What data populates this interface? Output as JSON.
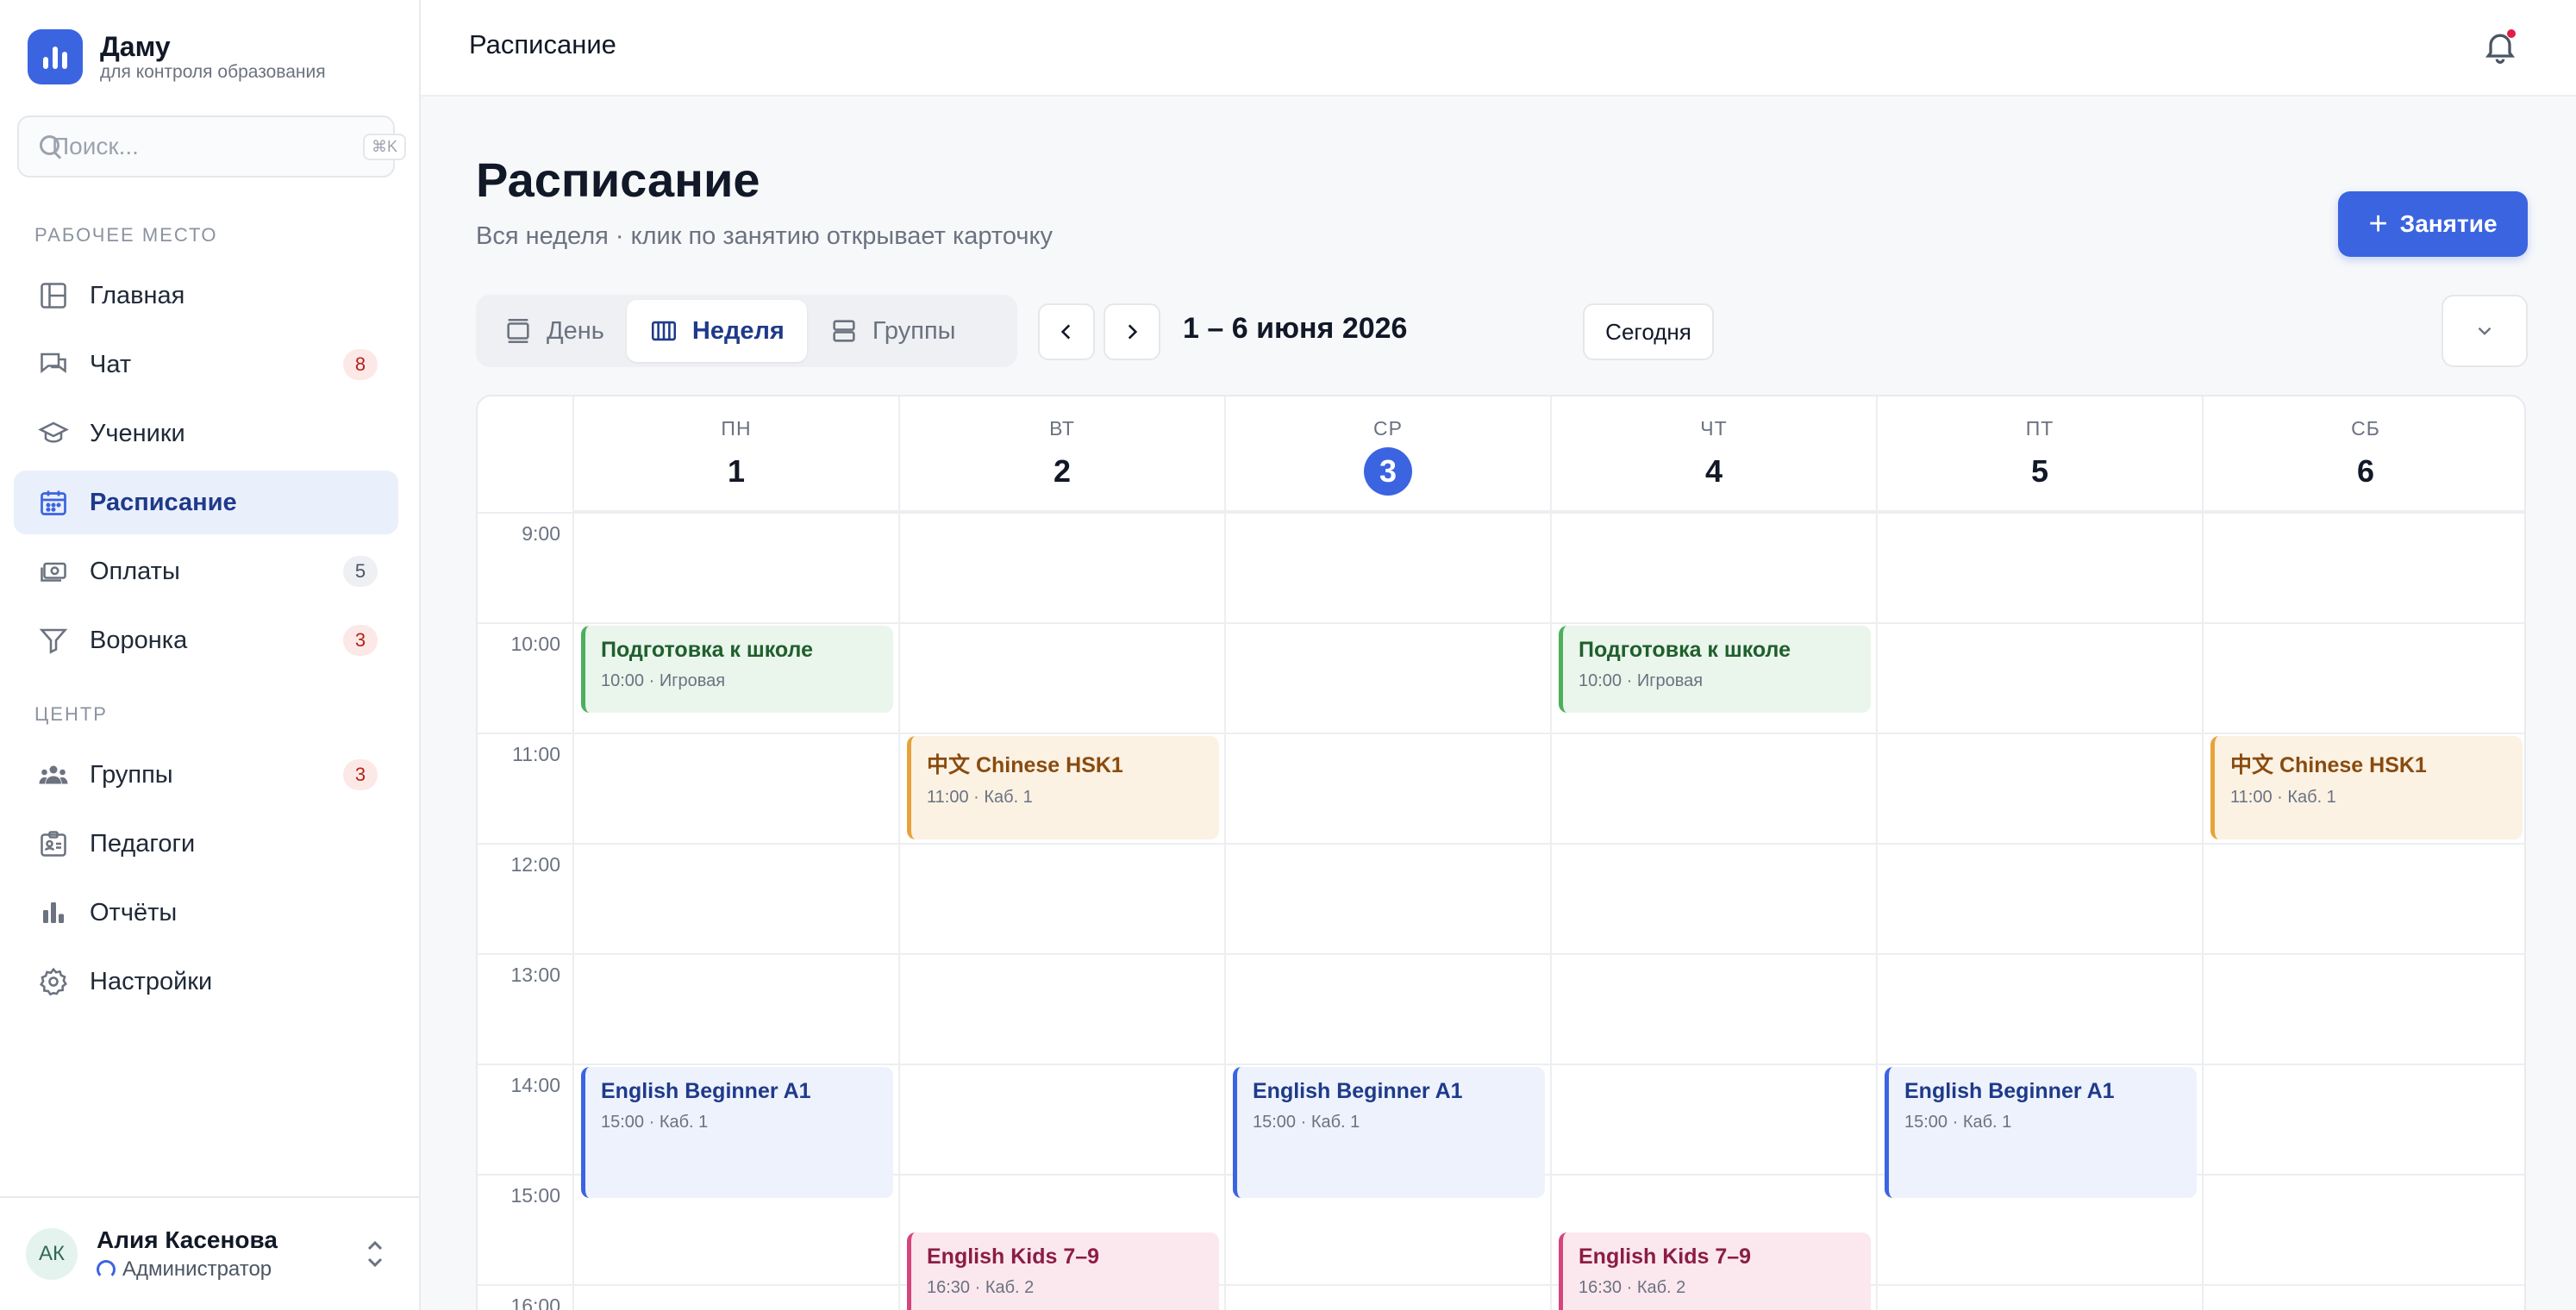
{
  "brand": {
    "name": "Даму",
    "subtitle": "для контроля образования"
  },
  "search": {
    "placeholder": "Поиск...",
    "shortcut": "⌘K"
  },
  "sidebar": {
    "workspace_label": "РАБОЧЕЕ МЕСТО",
    "center_label": "ЦЕНТР",
    "workspace_items": [
      {
        "label": "Главная",
        "icon": "layout-icon"
      },
      {
        "label": "Чат",
        "icon": "chat-icon",
        "badge": "8"
      },
      {
        "label": "Ученики",
        "icon": "graduation-cap-icon"
      },
      {
        "label": "Расписание",
        "icon": "calendar-icon",
        "active": true
      },
      {
        "label": "Оплаты",
        "icon": "cash-icon",
        "badge": "5"
      },
      {
        "label": "Воронка",
        "icon": "funnel-icon",
        "badge": "3"
      }
    ],
    "center_items": [
      {
        "label": "Группы",
        "icon": "users-icon",
        "badge": "3"
      },
      {
        "label": "Педагоги",
        "icon": "id-card-icon"
      },
      {
        "label": "Отчёты",
        "icon": "bar-chart-icon"
      },
      {
        "label": "Настройки",
        "icon": "gear-icon"
      }
    ]
  },
  "user": {
    "initials": "АК",
    "name": "Алия Касенова",
    "role": "Администратор"
  },
  "topbar": {
    "title": "Расписание"
  },
  "page": {
    "title": "Расписание",
    "subtitle": "Вся неделя · клик по занятию открывает карточку",
    "add_button": "Занятие"
  },
  "toolbar": {
    "views": [
      "День",
      "Неделя",
      "Группы"
    ],
    "active_view": "Неделя",
    "range": "1 – 6 июня 2026",
    "today_button": "Сегодня"
  },
  "calendar": {
    "days": [
      {
        "name": "ПН",
        "num": "1"
      },
      {
        "name": "ВТ",
        "num": "2"
      },
      {
        "name": "СР",
        "num": "3",
        "today": true
      },
      {
        "name": "ЧТ",
        "num": "4"
      },
      {
        "name": "ПТ",
        "num": "5"
      },
      {
        "name": "СБ",
        "num": "6"
      }
    ],
    "hours": [
      "9:00",
      "10:00",
      "11:00",
      "12:00",
      "13:00",
      "14:00",
      "15:00",
      "16:00"
    ],
    "events": [
      {
        "day": 0,
        "start": 10.0,
        "end": 10.85,
        "title": "Подготовка к школе",
        "meta": "10:00 · Игровая",
        "color": "green"
      },
      {
        "day": 3,
        "start": 10.0,
        "end": 10.85,
        "title": "Подготовка к школе",
        "meta": "10:00 · Игровая",
        "color": "green"
      },
      {
        "day": 1,
        "start": 11.0,
        "end": 12.0,
        "title": "中文 Chinese HSK1",
        "meta": "11:00 · Каб. 1",
        "color": "orange"
      },
      {
        "day": 5,
        "start": 11.0,
        "end": 12.0,
        "title": "中文 Chinese HSK1",
        "meta": "11:00 · Каб. 1",
        "color": "orange"
      },
      {
        "day": 0,
        "start": 14.0,
        "end": 15.25,
        "title": "English Beginner A1",
        "meta": "15:00 · Каб. 1",
        "color": "blue"
      },
      {
        "day": 2,
        "start": 14.0,
        "end": 15.25,
        "title": "English Beginner A1",
        "meta": "15:00 · Каб. 1",
        "color": "blue"
      },
      {
        "day": 4,
        "start": 14.0,
        "end": 15.25,
        "title": "English Beginner A1",
        "meta": "15:00 · Каб. 1",
        "color": "blue"
      },
      {
        "day": 1,
        "start": 15.5,
        "end": 16.5,
        "title": "English Kids 7–9",
        "meta": "16:30 · Каб. 2",
        "color": "pink"
      },
      {
        "day": 3,
        "start": 15.5,
        "end": 16.5,
        "title": "English Kids 7–9",
        "meta": "16:30 · Каб. 2",
        "color": "pink"
      }
    ]
  },
  "colors": {
    "accent": "#3b64e0",
    "badge_red": "#b42318"
  }
}
